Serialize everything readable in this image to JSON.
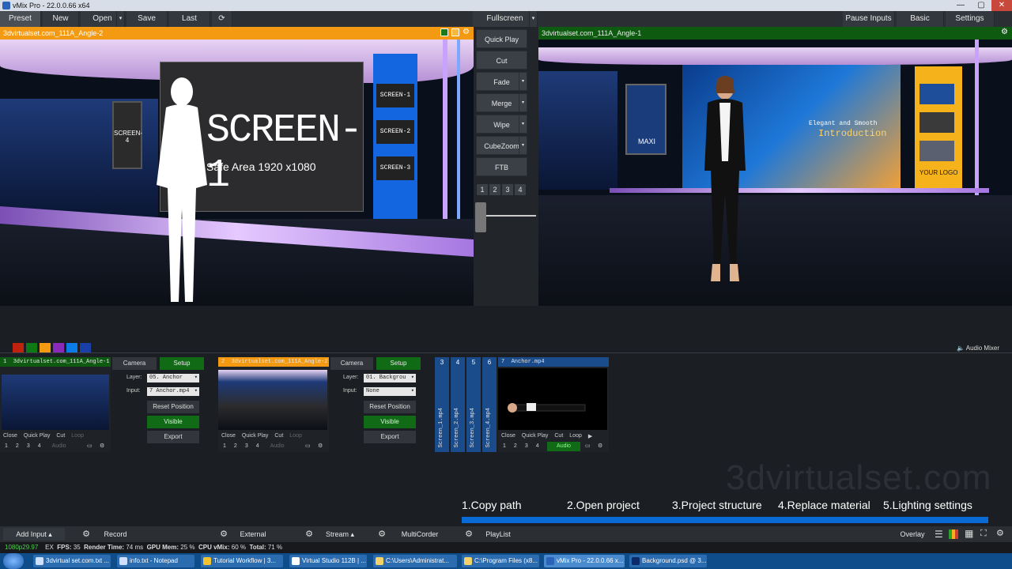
{
  "window": {
    "title": "vMix Pro - 22.0.0.66 x64",
    "controls": [
      "—",
      "▢",
      "✕"
    ]
  },
  "topmenu": {
    "preset": "Preset",
    "new": "New",
    "open": "Open",
    "save": "Save",
    "last": "Last",
    "fullscreen": "Fullscreen",
    "pause_inputs": "Pause Inputs",
    "basic": "Basic",
    "settings": "Settings"
  },
  "preview": {
    "title": "3dvirtualset.com_111A_Angle-2",
    "accent": "#f39a12"
  },
  "output": {
    "title": "3dvirtualset.com_111A_Angle-1",
    "accent": "#0e5a10"
  },
  "preview_scene": {
    "main_screen": "SCREEN-1",
    "safe_area": "Safe Area 1920 x1080",
    "side_screens": [
      "SCREEN-1",
      "SCREEN-2",
      "SCREEN-3"
    ],
    "left_screen": "SCREEN-4"
  },
  "output_scene": {
    "tagline_1": "Elegant and Smooth",
    "tagline_2": "Introduction",
    "logo": "YOUR LOGO",
    "panel_text": "MAXI"
  },
  "transitions": {
    "quick_play": "Quick Play",
    "cut": "Cut",
    "fade": "Fade",
    "merge": "Merge",
    "wipe": "Wipe",
    "cubezoom": "CubeZoom",
    "ftb": "FTB",
    "numbers": [
      "1",
      "2",
      "3",
      "4"
    ]
  },
  "color_swatches": [
    "#c0220e",
    "#0e7a16",
    "#f39a12",
    "#8a2ab8",
    "#0b7be8",
    "#1b3fa8"
  ],
  "audio_mixer": "Audio Mixer",
  "inputs": [
    {
      "number": "1",
      "title": "3dvirtualset.com_111A_Angle-1",
      "camera": "Camera",
      "setup": "Setup",
      "layer_label": "Layer:",
      "layer_value": "05. Anchor",
      "input_label": "Input:",
      "input_value": "7 Anchor.mp4",
      "reset": "Reset Position",
      "visible": "Visible",
      "export": "Export",
      "actions": [
        "Close",
        "Quick Play",
        "Cut",
        "Loop"
      ],
      "nums": [
        "1",
        "2",
        "3",
        "4"
      ],
      "audio": "Audio"
    },
    {
      "number": "2",
      "title": "3dvirtualset.com_111A_Angle-2",
      "camera": "Camera",
      "setup": "Setup",
      "layer_label": "Layer:",
      "layer_value": "01. Backgrou",
      "input_label": "Input:",
      "input_value": "None",
      "reset": "Reset Position",
      "visible": "Visible",
      "export": "Export",
      "actions": [
        "Close",
        "Quick Play",
        "Cut",
        "Loop"
      ],
      "nums": [
        "1",
        "2",
        "3",
        "4"
      ],
      "audio": "Audio"
    }
  ],
  "strips": [
    {
      "number": "3",
      "label": "Screen_1.mp4"
    },
    {
      "number": "4",
      "label": "Screen_2.mp4"
    },
    {
      "number": "5",
      "label": "Screen_3.mp4"
    },
    {
      "number": "6",
      "label": "Screen_4.mp4"
    }
  ],
  "anchor_input": {
    "number": "7",
    "title": "Anchor.mp4",
    "actions": [
      "Close",
      "Quick Play",
      "Cut",
      "Loop"
    ],
    "nums": [
      "1",
      "2",
      "3",
      "4"
    ],
    "audio": "Audio"
  },
  "watermark": "3dvirtualset.com",
  "workflow": [
    "1.Copy path",
    "2.Open project",
    "3.Project structure",
    "4.Replace material",
    "5.Lighting settings"
  ],
  "bottombar": {
    "add_input": "Add Input",
    "record": "Record",
    "external": "External",
    "stream": "Stream",
    "multicorder": "MultiCorder",
    "playlist": "PlayList",
    "overlay": "Overlay"
  },
  "status": {
    "format": "1080p29.97",
    "ex": "EX",
    "fps_label": "FPS:",
    "fps": "35",
    "render_label": "Render Time:",
    "render": "74 ms",
    "gpu_label": "GPU Mem:",
    "gpu": "25 %",
    "cpu_label": "CPU vMix:",
    "cpu": "60 %",
    "total_label": "Total:",
    "total": "71 %"
  },
  "taskbar": [
    "3dvirtual set.com.txt ...",
    "info.txt - Notepad",
    "Tutorial Workflow | 3...",
    "Virtual Studio 112B | ...",
    "C:\\Users\\Administrat...",
    "C:\\Program Files (x8...",
    "vMix Pro - 22.0.0.66 x...",
    "Background.psd @ 3..."
  ]
}
